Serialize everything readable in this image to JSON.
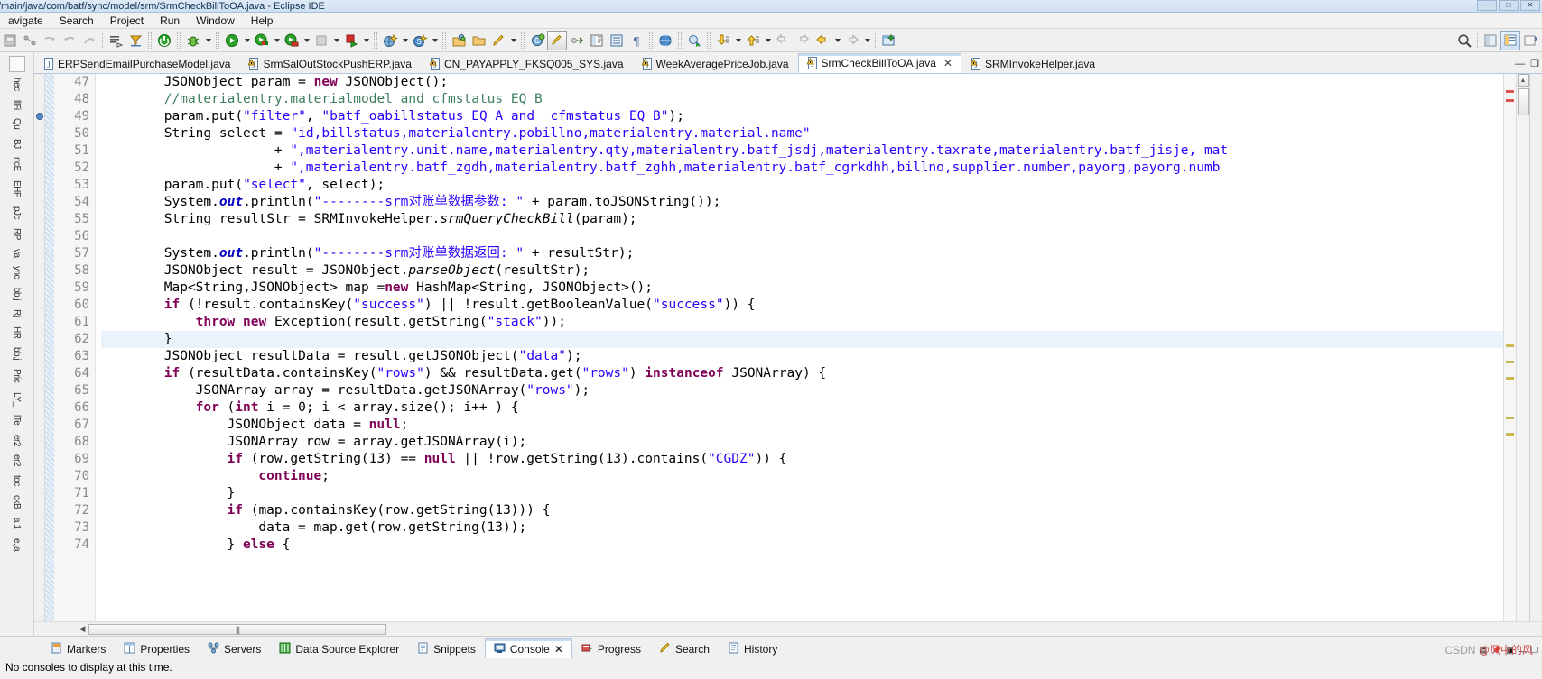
{
  "window": {
    "title": "/main/java/com/batf/sync/model/srm/SrmCheckBillToOA.java - Eclipse IDE",
    "buttons": [
      "–",
      "□",
      "✕"
    ]
  },
  "menubar": {
    "items": [
      {
        "label": "avigate",
        "name": "menu-navigate"
      },
      {
        "label": "Search",
        "name": "menu-search"
      },
      {
        "label": "Project",
        "name": "menu-project"
      },
      {
        "label": "Run",
        "name": "menu-run"
      },
      {
        "label": "Window",
        "name": "menu-window"
      },
      {
        "label": "Help",
        "name": "menu-help"
      }
    ]
  },
  "toolbar": {
    "icons": [
      "save-icon",
      "new-java-project-icon",
      "undo-icon",
      "redo-icon",
      "forward-icon",
      "skip-breakpoints-icon",
      "run-last-tool-icon",
      "terminate-icon",
      "debug-icon",
      "run-icon",
      "run-as-server-icon",
      "profile-icon",
      "stop-icon",
      "run-to-line-icon",
      "new-wizard-icon",
      "search-icon-sm",
      "open-type-icon",
      "open-folder-icon",
      "edit-icon",
      "new-java-class-icon",
      "pencil-highlight-icon",
      "link-icon",
      "toggle-view-icon",
      "outline-icon",
      "pilcrow-icon",
      "globe-icon",
      "search-ref-icon",
      "next-annotation-icon",
      "prev-annotation-icon",
      "back-history-icon",
      "forward-history-icon",
      "back-arrow-icon",
      "forward-arrow-icon",
      "new-window-icon"
    ],
    "right_icons": [
      "search-magnifier-icon",
      "perspective-java-icon",
      "perspective-debug-icon",
      "open-perspective-icon"
    ]
  },
  "editor_tabs": {
    "items": [
      {
        "label": "ERPSendEmailPurchaseModel.java",
        "active": false,
        "dirty": false
      },
      {
        "label": "SrmSalOutStockPushERP.java",
        "active": false,
        "dirty": true
      },
      {
        "label": "CN_PAYAPPLY_FKSQ005_SYS.java",
        "active": false,
        "dirty": true
      },
      {
        "label": "WeekAveragePriceJob.java",
        "active": false,
        "dirty": true
      },
      {
        "label": "SrmCheckBillToOA.java",
        "active": true,
        "dirty": true
      },
      {
        "label": "SRMInvokeHelper.java",
        "active": false,
        "dirty": true
      }
    ],
    "close_glyph": "✕",
    "minimize_glyph": "—",
    "maximize_glyph": "❐"
  },
  "left_bar": {
    "labels": [
      "hec",
      "llFi",
      "Qu",
      "BJ",
      "ncE",
      "EHF",
      "pJc",
      "RP",
      "va",
      "ync",
      "bb.j",
      "Rj",
      "HR",
      "bb.j",
      "Pric",
      "LY_",
      "lTe",
      "er2",
      "er2",
      "toc",
      "ckB",
      "a 1",
      "e.ja"
    ]
  },
  "code": {
    "current_line": 62,
    "breakpoint_line": 49,
    "lines": [
      {
        "n": 47,
        "indent": 4,
        "tokens": [
          {
            "t": "JSONObject param = ",
            "c": "pln"
          },
          {
            "t": "new",
            "c": "kw"
          },
          {
            "t": " JSONObject();",
            "c": "pln"
          }
        ]
      },
      {
        "n": 48,
        "indent": 4,
        "tokens": [
          {
            "t": "//materialentry.materialmodel and cfmstatus EQ B",
            "c": "cmt"
          }
        ]
      },
      {
        "n": 49,
        "indent": 4,
        "tokens": [
          {
            "t": "param.put(",
            "c": "pln"
          },
          {
            "t": "\"filter\"",
            "c": "str"
          },
          {
            "t": ", ",
            "c": "pln"
          },
          {
            "t": "\"batf_oabillstatus EQ A and  cfmstatus EQ B\"",
            "c": "str"
          },
          {
            "t": ");",
            "c": "pln"
          }
        ]
      },
      {
        "n": 50,
        "indent": 4,
        "tokens": [
          {
            "t": "String select = ",
            "c": "pln"
          },
          {
            "t": "\"id,billstatus,materialentry.pobillno,materialentry.material.name\"",
            "c": "str"
          }
        ]
      },
      {
        "n": 51,
        "indent": 4,
        "pad": 18,
        "tokens": [
          {
            "t": "+ ",
            "c": "pln"
          },
          {
            "t": "\",materialentry.unit.name,materialentry.qty,materialentry.batf_jsdj,materialentry.taxrate,materialentry.batf_jisje, mat",
            "c": "str"
          }
        ]
      },
      {
        "n": 52,
        "indent": 4,
        "pad": 18,
        "tokens": [
          {
            "t": "+ ",
            "c": "pln"
          },
          {
            "t": "\",materialentry.batf_zgdh,materialentry.batf_zghh,materialentry.batf_cgrkdhh,billno,supplier.number,payorg,payorg.numb",
            "c": "str"
          }
        ]
      },
      {
        "n": 53,
        "indent": 4,
        "tokens": [
          {
            "t": "param.put(",
            "c": "pln"
          },
          {
            "t": "\"select\"",
            "c": "str"
          },
          {
            "t": ", select);",
            "c": "pln"
          }
        ]
      },
      {
        "n": 54,
        "indent": 4,
        "tokens": [
          {
            "t": "System.",
            "c": "pln"
          },
          {
            "t": "out",
            "c": "fld"
          },
          {
            "t": ".println(",
            "c": "pln"
          },
          {
            "t": "\"--------srm对账单数据参数: \"",
            "c": "str"
          },
          {
            "t": " + param.toJSONString());",
            "c": "pln"
          }
        ]
      },
      {
        "n": 55,
        "indent": 4,
        "tokens": [
          {
            "t": "String resultStr = SRMInvokeHelper.",
            "c": "pln"
          },
          {
            "t": "srmQueryCheckBill",
            "c": "mth"
          },
          {
            "t": "(param);",
            "c": "pln"
          }
        ]
      },
      {
        "n": 56,
        "indent": 0,
        "tokens": []
      },
      {
        "n": 57,
        "indent": 4,
        "tokens": [
          {
            "t": "System.",
            "c": "pln"
          },
          {
            "t": "out",
            "c": "fld"
          },
          {
            "t": ".println(",
            "c": "pln"
          },
          {
            "t": "\"--------srm对账单数据返回: \"",
            "c": "str"
          },
          {
            "t": " + resultStr);",
            "c": "pln"
          }
        ]
      },
      {
        "n": 58,
        "indent": 4,
        "tokens": [
          {
            "t": "JSONObject result = JSONObject.",
            "c": "pln"
          },
          {
            "t": "parseObject",
            "c": "mth"
          },
          {
            "t": "(resultStr);",
            "c": "pln"
          }
        ]
      },
      {
        "n": 59,
        "indent": 4,
        "tokens": [
          {
            "t": "Map<String,JSONObject> map =",
            "c": "pln"
          },
          {
            "t": "new",
            "c": "kw"
          },
          {
            "t": " HashMap<String, JSONObject>();",
            "c": "pln"
          }
        ]
      },
      {
        "n": 60,
        "indent": 4,
        "tokens": [
          {
            "t": "if",
            "c": "kw"
          },
          {
            "t": " (!result.containsKey(",
            "c": "pln"
          },
          {
            "t": "\"success\"",
            "c": "str"
          },
          {
            "t": ") || !result.getBooleanValue(",
            "c": "pln"
          },
          {
            "t": "\"success\"",
            "c": "str"
          },
          {
            "t": ")) {",
            "c": "pln"
          }
        ]
      },
      {
        "n": 61,
        "indent": 8,
        "tokens": [
          {
            "t": "throw",
            "c": "kw"
          },
          {
            "t": " ",
            "c": "pln"
          },
          {
            "t": "new",
            "c": "kw"
          },
          {
            "t": " Exception(result.getString(",
            "c": "pln"
          },
          {
            "t": "\"stack\"",
            "c": "str"
          },
          {
            "t": "));",
            "c": "pln"
          }
        ]
      },
      {
        "n": 62,
        "indent": 4,
        "tokens": [
          {
            "t": "}",
            "c": "pln"
          }
        ]
      },
      {
        "n": 63,
        "indent": 4,
        "tokens": [
          {
            "t": "JSONObject resultData = result.getJSONObject(",
            "c": "pln"
          },
          {
            "t": "\"data\"",
            "c": "str"
          },
          {
            "t": ");",
            "c": "pln"
          }
        ]
      },
      {
        "n": 64,
        "indent": 4,
        "tokens": [
          {
            "t": "if",
            "c": "kw"
          },
          {
            "t": " (resultData.containsKey(",
            "c": "pln"
          },
          {
            "t": "\"rows\"",
            "c": "str"
          },
          {
            "t": ") && resultData.get(",
            "c": "pln"
          },
          {
            "t": "\"rows\"",
            "c": "str"
          },
          {
            "t": ") ",
            "c": "pln"
          },
          {
            "t": "instanceof",
            "c": "kw"
          },
          {
            "t": " JSONArray) {",
            "c": "pln"
          }
        ]
      },
      {
        "n": 65,
        "indent": 8,
        "tokens": [
          {
            "t": "JSONArray array = resultData.getJSONArray(",
            "c": "pln"
          },
          {
            "t": "\"rows\"",
            "c": "str"
          },
          {
            "t": ");",
            "c": "pln"
          }
        ]
      },
      {
        "n": 66,
        "indent": 8,
        "tokens": [
          {
            "t": "for",
            "c": "kw"
          },
          {
            "t": " (",
            "c": "pln"
          },
          {
            "t": "int",
            "c": "kw"
          },
          {
            "t": " i = 0; i < array.size(); i++ ) {",
            "c": "pln"
          }
        ]
      },
      {
        "n": 67,
        "indent": 12,
        "tokens": [
          {
            "t": "JSONObject data = ",
            "c": "pln"
          },
          {
            "t": "null",
            "c": "kw"
          },
          {
            "t": ";",
            "c": "pln"
          }
        ]
      },
      {
        "n": 68,
        "indent": 12,
        "tokens": [
          {
            "t": "JSONArray row = array.getJSONArray(i);",
            "c": "pln"
          }
        ]
      },
      {
        "n": 69,
        "indent": 12,
        "tokens": [
          {
            "t": "if",
            "c": "kw"
          },
          {
            "t": " (row.getString(13) == ",
            "c": "pln"
          },
          {
            "t": "null",
            "c": "kw"
          },
          {
            "t": " || !row.getString(13).contains(",
            "c": "pln"
          },
          {
            "t": "\"CGDZ\"",
            "c": "str"
          },
          {
            "t": ")) {",
            "c": "pln"
          }
        ]
      },
      {
        "n": 70,
        "indent": 16,
        "tokens": [
          {
            "t": "continue",
            "c": "kw"
          },
          {
            "t": ";",
            "c": "pln"
          }
        ]
      },
      {
        "n": 71,
        "indent": 12,
        "tokens": [
          {
            "t": "}",
            "c": "pln"
          }
        ]
      },
      {
        "n": 72,
        "indent": 12,
        "tokens": [
          {
            "t": "if",
            "c": "kw"
          },
          {
            "t": " (map.containsKey(row.getString(13))) {",
            "c": "pln"
          }
        ]
      },
      {
        "n": 73,
        "indent": 16,
        "tokens": [
          {
            "t": "data = map.get(row.getString(13));",
            "c": "pln"
          }
        ]
      },
      {
        "n": 74,
        "indent": 12,
        "tokens": [
          {
            "t": "} ",
            "c": "pln"
          },
          {
            "t": "else",
            "c": "kw"
          },
          {
            "t": " {",
            "c": "pln"
          }
        ]
      }
    ]
  },
  "hscroll": {
    "left_glyph": "◀",
    "grip": "|||"
  },
  "vscroll": {
    "up_glyph": "▲",
    "down_glyph": "▼"
  },
  "bottom_tabs": {
    "items": [
      {
        "label": "Markers",
        "icon": "markers-icon",
        "active": false
      },
      {
        "label": "Properties",
        "icon": "properties-icon",
        "active": false
      },
      {
        "label": "Servers",
        "icon": "servers-icon",
        "active": false
      },
      {
        "label": "Data Source Explorer",
        "icon": "data-source-explorer-icon",
        "active": false
      },
      {
        "label": "Snippets",
        "icon": "snippets-icon",
        "active": false
      },
      {
        "label": "Console",
        "icon": "console-icon",
        "active": true
      },
      {
        "label": "Progress",
        "icon": "progress-icon",
        "active": false
      },
      {
        "label": "Search",
        "icon": "search-view-icon",
        "active": false
      },
      {
        "label": "History",
        "icon": "history-icon",
        "active": false
      }
    ],
    "close_glyph": "✕",
    "right_icons": [
      "console-toolbar-icon",
      "pin-console-icon",
      "new-console-icon",
      "minimize-icon",
      "maximize-icon"
    ]
  },
  "console": {
    "message": "No consoles to display at this time."
  },
  "watermark": {
    "prefix": "CSDN ",
    "handle": "@风中的风"
  }
}
